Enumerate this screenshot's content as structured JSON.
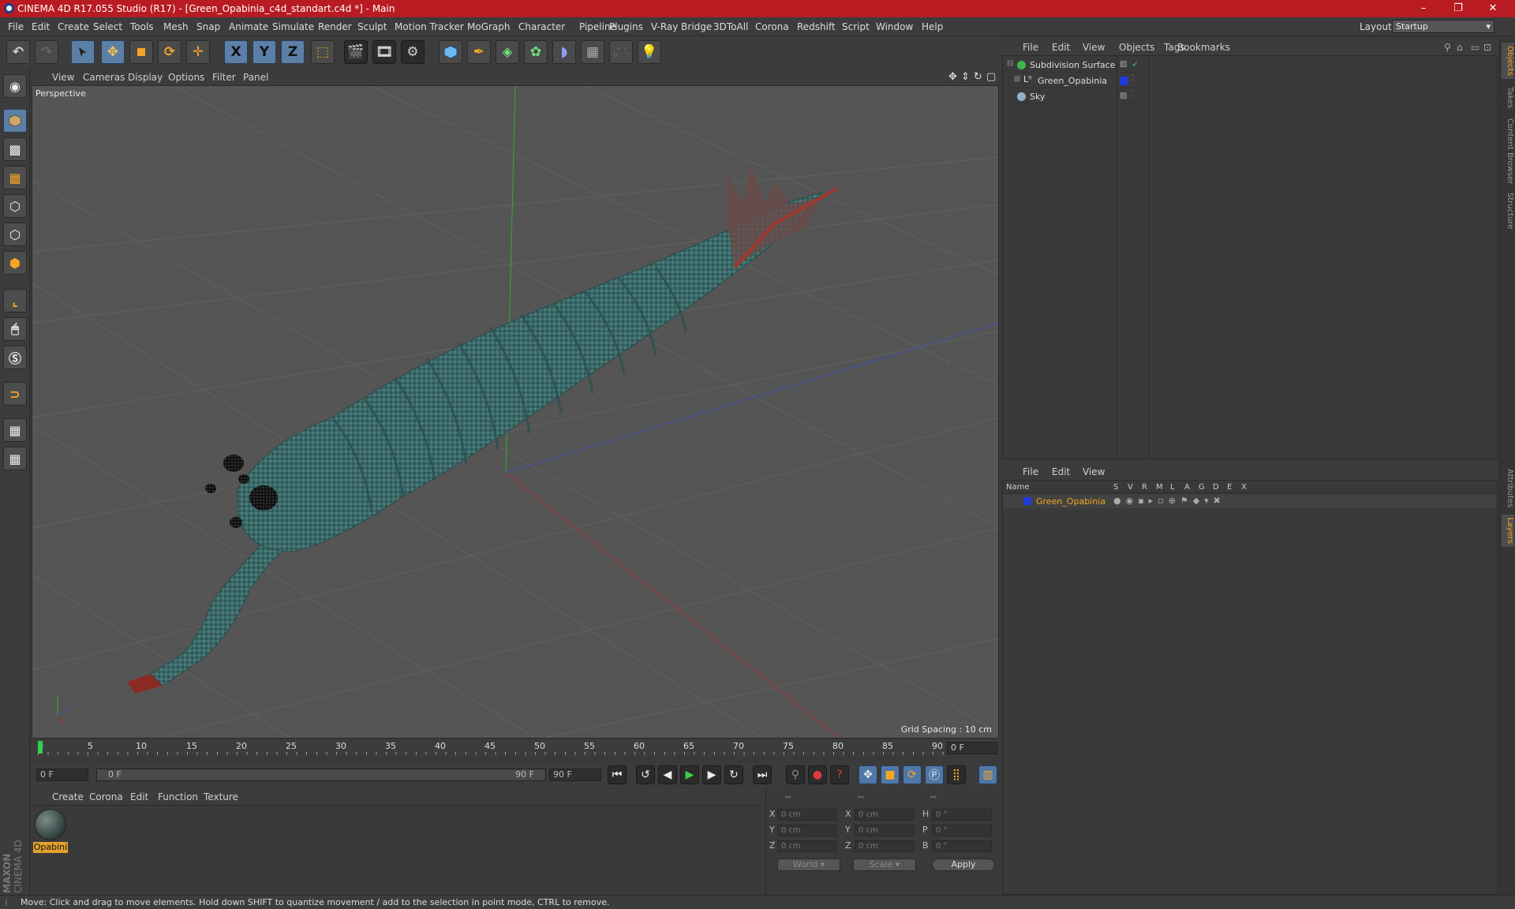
{
  "window": {
    "title": "CINEMA 4D R17.055 Studio (R17) - [Green_Opabinia_c4d_standart.c4d *] - Main",
    "controls": [
      "–",
      "❐",
      "✕"
    ]
  },
  "menubar": {
    "items": [
      "File",
      "Edit",
      "Create",
      "Select",
      "Tools",
      "Mesh",
      "Snap",
      "Animate",
      "Simulate",
      "Render",
      "Sculpt",
      "Motion Tracker",
      "MoGraph",
      "Character",
      "Pipeline",
      "Plugins",
      "V-Ray Bridge",
      "3DToAll",
      "Corona",
      "Redshift",
      "Script",
      "Window",
      "Help"
    ],
    "layout_label": "Layout:",
    "layout_value": "Startup"
  },
  "toolbar": {
    "tools": [
      "undo-icon",
      "redo-icon",
      "select-arrow-icon",
      "move-icon",
      "scale-icon",
      "rotate-icon",
      "live-move-icon",
      "x-axis-icon",
      "y-axis-icon",
      "z-axis-icon",
      "coord-system-icon",
      "render-view-icon",
      "render-picture-viewer-icon",
      "render-settings-icon",
      "cube-icon",
      "pen-spline-icon",
      "subdivision-icon",
      "cloner-icon",
      "deformer-icon",
      "floor-icon",
      "camera-icon",
      "light-icon"
    ],
    "axis_labels": [
      "X",
      "Y",
      "Z"
    ]
  },
  "left_tools": [
    "model-icon",
    "texture-icon",
    "workplane-icon",
    "points-icon",
    "edges-icon",
    "polygons-icon",
    "axis-icon",
    "tweak-icon",
    "snap-s-icon",
    "magnet-icon",
    "grid-lock-icon",
    "grid-icon"
  ],
  "viewport": {
    "menu": [
      "View",
      "Cameras",
      "Display",
      "Options",
      "Filter",
      "Panel"
    ],
    "camera_label": "Perspective",
    "grid_spacing": "Grid Spacing : 10 cm"
  },
  "timeline": {
    "ticks": [
      "0",
      "5",
      "10",
      "15",
      "20",
      "25",
      "30",
      "35",
      "40",
      "45",
      "50",
      "55",
      "60",
      "65",
      "70",
      "75",
      "80",
      "85",
      "90"
    ],
    "current_frame": "0 F"
  },
  "transport": {
    "start_field": "0 F",
    "range_start": "0 F",
    "range_end": "90 F",
    "end_field": "90 F"
  },
  "material_manager": {
    "menu": [
      "Create",
      "Corona",
      "Edit",
      "Function",
      "Texture"
    ],
    "material_name": "Opabini"
  },
  "coordinates": {
    "headers": [
      "--",
      "--",
      "--"
    ],
    "rows": [
      {
        "a": "X",
        "av": "0 cm",
        "b": "X",
        "bv": "0 cm",
        "c": "H",
        "cv": "0 °"
      },
      {
        "a": "Y",
        "av": "0 cm",
        "b": "Y",
        "bv": "0 cm",
        "c": "P",
        "cv": "0 °"
      },
      {
        "a": "Z",
        "av": "0 cm",
        "b": "Z",
        "bv": "0 cm",
        "c": "B",
        "cv": "0 °"
      }
    ],
    "mode": "World",
    "scale": "Scale",
    "apply": "Apply"
  },
  "object_manager": {
    "menu": [
      "File",
      "Edit",
      "View",
      "Objects",
      "Tags",
      "Bookmarks"
    ],
    "objects": [
      {
        "name": "Subdivision Surface",
        "color": "#3fb34f"
      },
      {
        "name": "Green_Opabinia",
        "color": "#e8e8e8"
      },
      {
        "name": "Sky",
        "color": "#8fb0d0"
      }
    ]
  },
  "layer_manager": {
    "menu": [
      "File",
      "Edit",
      "View"
    ],
    "columns": [
      "Name",
      "S",
      "V",
      "R",
      "M",
      "L",
      "A",
      "G",
      "D",
      "E",
      "X"
    ],
    "layer_name": "Green_Opabinia",
    "layer_color": "#1f3bd8"
  },
  "side_tabs": [
    "Objects",
    "Takes",
    "Content Browser",
    "Structure",
    "Attributes",
    "Layers"
  ],
  "status": {
    "message": "Move: Click and drag to move elements. Hold down SHIFT to quantize movement / add to the selection in point mode, CTRL to remove."
  },
  "brand": {
    "logo_line1": "MAXON",
    "logo_line2": "CINEMA 4D",
    "accent": "#f5a623",
    "title_red": "#b81c22"
  }
}
